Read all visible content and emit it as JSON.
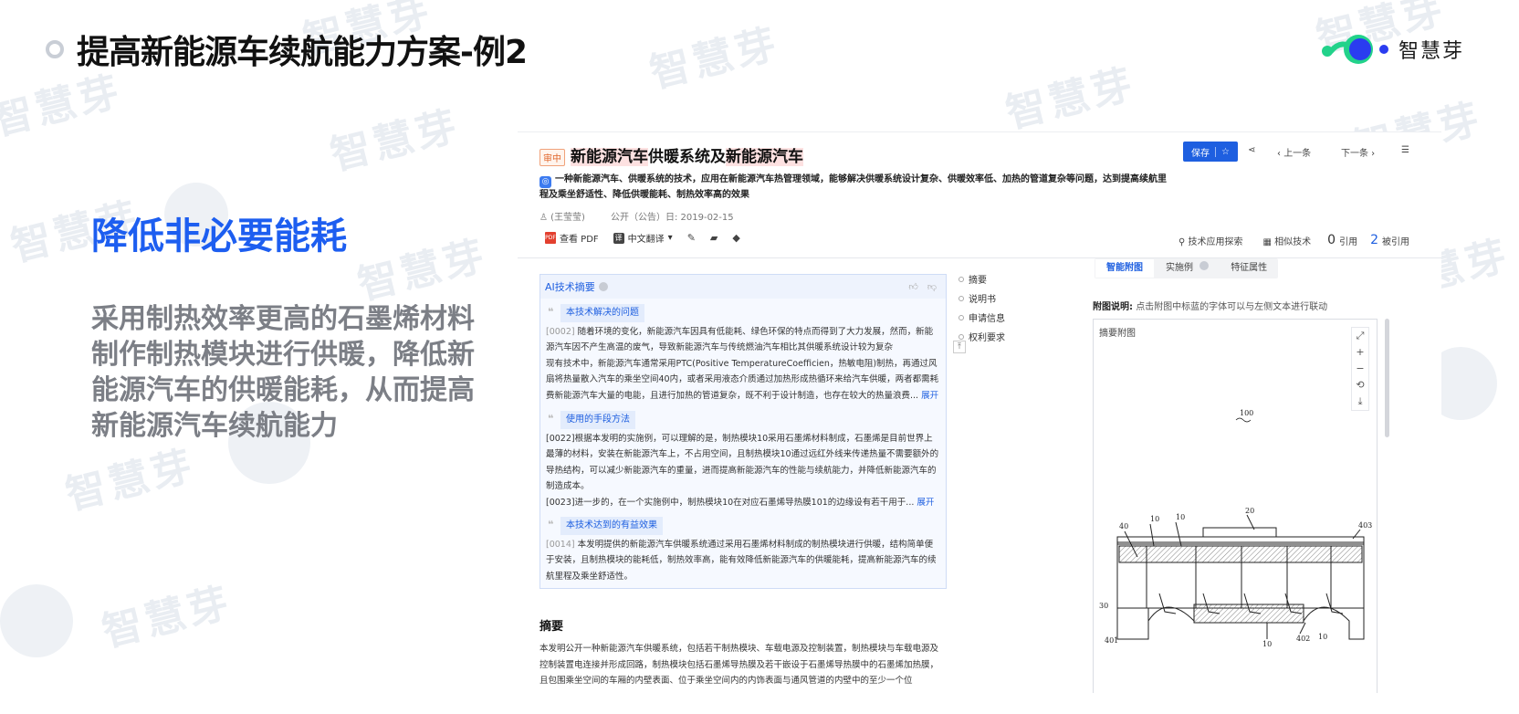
{
  "slide": {
    "title": "提高新能源车续航能力方案-例2",
    "subhead": "降低非必要能耗",
    "body": "采用制热效率更高的石墨烯材料制作制热模块进行供暖，降低新能源汽车的供暖能耗，从而提高新能源汽车续航能力",
    "logo_text": "智慧芽",
    "watermark": "智慧芽"
  },
  "patent": {
    "status_badge": "审中",
    "title_part1": "新能源汽车",
    "title_part2": "供暖系统及",
    "title_part3": "新能源汽车",
    "ai_summary": "一种新能源汽车、供暖系统的技术，应用在新能源汽车热管理领域，能够解决供暖系统设计复杂、供暖效率低、加热的管道复杂等问题，达到提高续航里程及乘坐舒适性、降低供暖能耗、制热效率高的效果",
    "inventor": "(王莹莹)",
    "pub_date": "公开（公告）日: 2019-02-15",
    "toolbar": {
      "pdf": "查看 PDF",
      "translate": "中文翻译",
      "pdf_icon": "PDF",
      "translate_icon": "译"
    },
    "header_actions": {
      "save": "保存",
      "prev": "上一条",
      "next": "下一条"
    },
    "right_tools": {
      "tech_explore": "技术应用探索",
      "similar": "相似技术",
      "cite_count": "0",
      "cite_label": "引用",
      "cited_count": "2",
      "cited_label": "被引用"
    }
  },
  "ai_box": {
    "header": "AI技术摘要",
    "sections": [
      {
        "tag": "本技术解决的问题",
        "para_num": "[0002]",
        "text": "随着环境的变化，新能源汽车因具有低能耗、绿色环保的特点而得到了大力发展，然而，新能源汽车因不产生高温的废气，导致新能源汽车与传统燃油汽车相比其供暖系统设计较为复杂",
        "text2": "现有技术中，新能源汽车通常采用PTC(Positive TemperatureCoefficien，热敏电阻)制热，再通过风扇将热量散入汽车的乘坐空间40内，或者采用液态介质通过加热形成热循环来给汽车供暖，两者都需耗费新能源汽车大量的电能，且进行加热的管道复杂，既不利于设计制造，也存在较大的热量浪费...",
        "expand": "展开"
      },
      {
        "tag": "使用的手段方法",
        "text": "[0022]根据本发明的实施例，可以理解的是，制热模块10采用石墨烯材料制成，石墨烯是目前世界上最薄的材料，安装在新能源汽车上，不占用空间，且制热模块10通过远红外线来传递热量不需要额外的导热结构，可以减少新能源汽车的重量，进而提高新能源汽车的性能与续航能力，并降低新能源汽车的制造成本。",
        "text2": "[0023]进一步的，在一个实施例中，制热模块10在对应石墨烯导热膜101的边缘设有若干用于...",
        "expand": "展开"
      },
      {
        "tag": "本技术达到的有益效果",
        "para_num": "[0014]",
        "text": "本发明提供的新能源汽车供暖系统通过采用石墨烯材料制成的制热模块进行供暖，结构简单便于安装，且制热模块的能耗低，制热效率高，能有效降低新能源汽车的供暖能耗，提高新能源汽车的续航里程及乘坐舒适性。"
      }
    ]
  },
  "nav": [
    "摘要",
    "说明书",
    "申请信息",
    "权利要求"
  ],
  "abstract": {
    "title": "摘要",
    "text": "本发明公开一种新能源汽车供暖系统，包括若干制热模块、车载电源及控制装置，制热模块与车载电源及控制装置电连接并形成回路，制热模块包括石墨烯导热膜及若干嵌设于石墨烯导热膜中的石墨烯加热膜，且包围乘坐空间的车厢的内壁表面、位于乘坐空间内的内饰表面与通风管道的内壁中的至少一个位"
  },
  "figure": {
    "tabs": [
      "智能附图",
      "实施例",
      "特征属性"
    ],
    "caption_label": "附图说明:",
    "caption_text": "点击附图中标蓝的字体可以与左侧文本进行联动",
    "box_label": "摘要附图",
    "labels": [
      "100",
      "20",
      "10",
      "10",
      "40",
      "403",
      "30",
      "401",
      "10",
      "402",
      "10"
    ]
  },
  "colors": {
    "accent": "#1e5fe0",
    "title": "#111111",
    "subhead": "#1d5ef0",
    "body": "#7c7f86",
    "highlight": "#fbd8d8"
  }
}
